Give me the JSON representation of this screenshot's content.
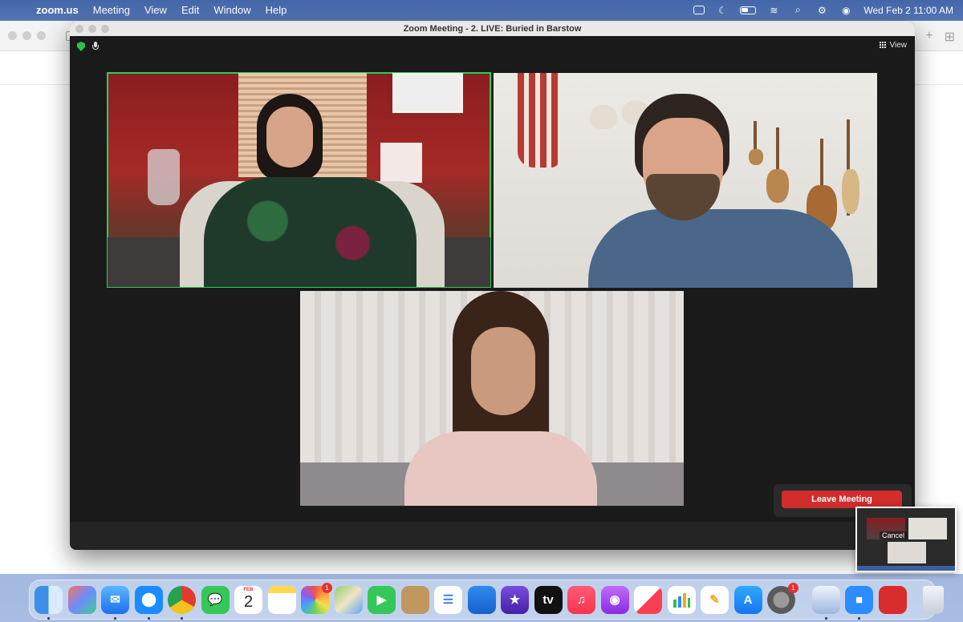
{
  "menubar": {
    "apple_glyph": "",
    "app_name": "zoom.us",
    "menus": [
      "Meeting",
      "View",
      "Edit",
      "Window",
      "Help"
    ],
    "clock": "Wed Feb 2  11:00 AM"
  },
  "zoom": {
    "window_title": "Zoom Meeting - 2. LIVE: Buried in Barstow",
    "view_label": "View",
    "leave_label": "Leave Meeting",
    "mini_cancel_label": "Cancel",
    "active_border_color": "#27d05a",
    "leave_color": "#d22c2c"
  },
  "dock": {
    "calendar": {
      "month": "FEB",
      "day": "2"
    },
    "photos_badge": "1",
    "settings_badge": "1",
    "tv_label": "tv",
    "apps": [
      "finder-icon",
      "launchpad-icon",
      "mail-icon",
      "safari-icon",
      "chrome-icon",
      "messages-icon",
      "calendar-icon",
      "notes-icon",
      "photos-icon",
      "maps-icon",
      "facetime-icon",
      "contacts-icon",
      "reminders-icon",
      "keynote-icon",
      "imovie-icon",
      "apple-tv-icon",
      "music-icon",
      "podcasts-icon",
      "news-icon",
      "numbers-icon",
      "pages-icon",
      "app-store-icon",
      "system-preferences-icon",
      "preview-icon",
      "zoom-icon",
      "photo-booth-icon",
      "trash-icon"
    ]
  }
}
